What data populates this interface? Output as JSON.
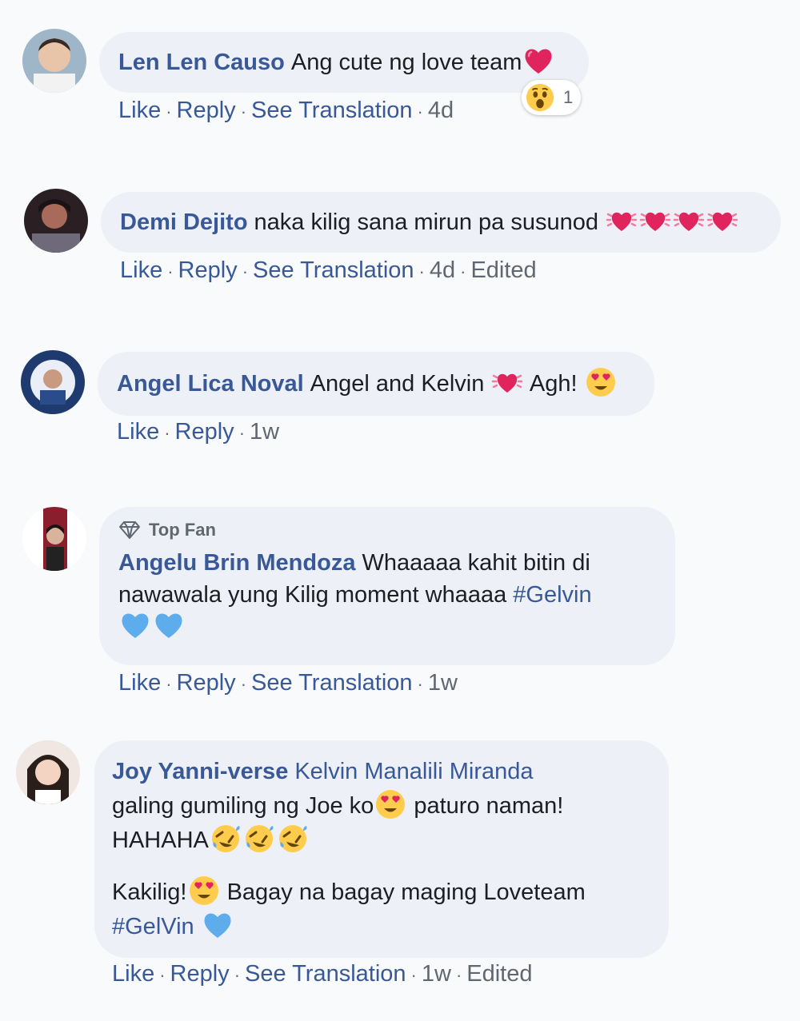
{
  "comments": [
    {
      "author": "Len Len Causo",
      "text": "Ang cute ng love team",
      "actions": {
        "like": "Like",
        "reply": "Reply",
        "translate": "See Translation",
        "time": "4d"
      },
      "reaction": {
        "icon": "wow-emoji",
        "count": "1"
      },
      "emojis": [
        "red-heart-emoji"
      ]
    },
    {
      "author": "Demi Dejito",
      "text": "naka kilig sana mirun pa susunod",
      "actions": {
        "like": "Like",
        "reply": "Reply",
        "translate": "See Translation",
        "time": "4d",
        "edited": "Edited"
      },
      "emojis": [
        "beating-heart-emoji",
        "beating-heart-emoji",
        "beating-heart-emoji",
        "beating-heart-emoji"
      ]
    },
    {
      "author": "Angel Lica Noval",
      "text_a": "Angel and Kelvin",
      "text_b": "Agh!",
      "actions": {
        "like": "Like",
        "reply": "Reply",
        "time": "1w"
      },
      "emojis": [
        "beating-heart-emoji",
        "heart-eyes-emoji"
      ]
    },
    {
      "badge": "Top Fan",
      "author": "Angelu Brin Mendoza",
      "text_line1": "Whaaaaa kahit bitin di",
      "text_line2": "nawawala yung Kilig moment whaaaa",
      "hashtag": "#Gelvin",
      "actions": {
        "like": "Like",
        "reply": "Reply",
        "translate": "See Translation",
        "time": "1w"
      },
      "emojis": [
        "blue-heart-emoji",
        "blue-heart-emoji"
      ]
    },
    {
      "author": "Joy Yanni-verse",
      "mention": "Kelvin Manalili Miranda",
      "line2_a": "galing gumiling ng Joe ko",
      "line2_b": "paturo naman!",
      "line3": "HAHAHA",
      "line4_a": "Kakilig!",
      "line4_b": "Bagay na bagay maging Loveteam",
      "hashtag": "#GelVin",
      "actions": {
        "like": "Like",
        "reply": "Reply",
        "translate": "See Translation",
        "time": "1w",
        "edited": "Edited"
      },
      "emojis": [
        "heart-eyes-emoji",
        "rofl-emoji",
        "blue-heart-emoji"
      ]
    }
  ],
  "colors": {
    "link": "#385898",
    "bubble": "#edf0f7",
    "meta": "#606770",
    "background": "#f9fafc"
  }
}
